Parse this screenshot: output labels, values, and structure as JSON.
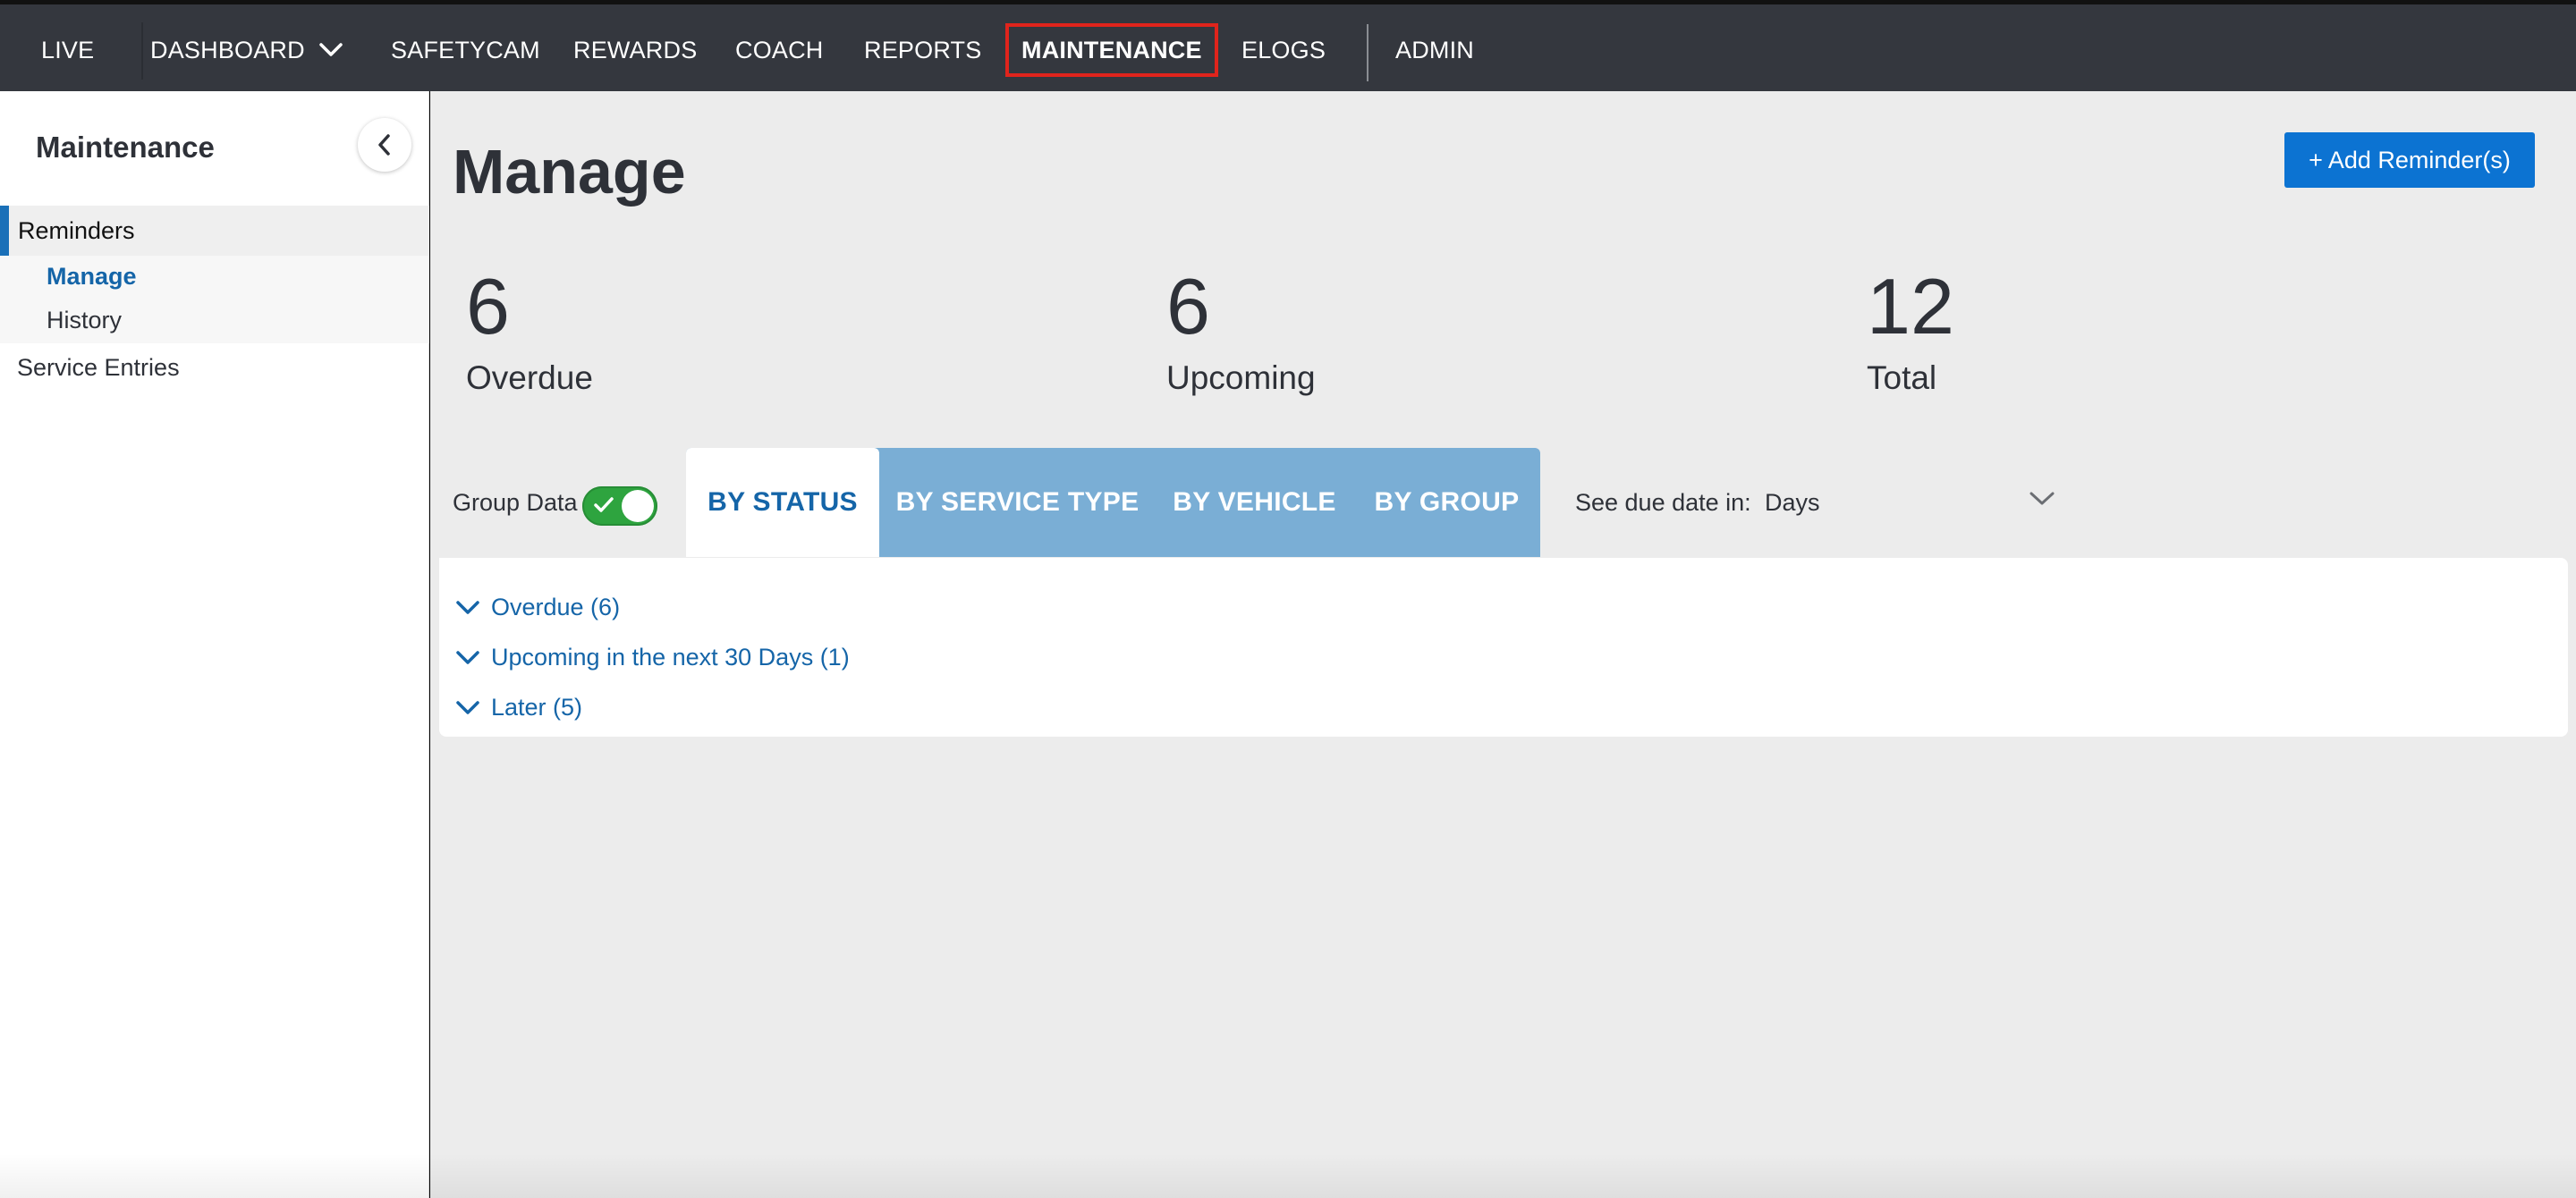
{
  "topnav": {
    "items": [
      {
        "label": "LIVE"
      },
      {
        "label": "DASHBOARD"
      },
      {
        "label": "SAFETYCAM"
      },
      {
        "label": "REWARDS"
      },
      {
        "label": "COACH"
      },
      {
        "label": "REPORTS"
      },
      {
        "label": "MAINTENANCE",
        "active": true
      },
      {
        "label": "ELOGS"
      },
      {
        "label": "ADMIN"
      }
    ]
  },
  "sidebar": {
    "title": "Maintenance",
    "sections": [
      {
        "label": "Reminders",
        "children": [
          {
            "label": "Manage",
            "active": true
          },
          {
            "label": "History"
          }
        ]
      },
      {
        "label": "Service Entries"
      }
    ]
  },
  "main": {
    "title": "Manage",
    "add_button": "+ Add Reminder(s)",
    "stats": [
      {
        "value": "6",
        "label": "Overdue"
      },
      {
        "value": "6",
        "label": "Upcoming"
      },
      {
        "value": "12",
        "label": "Total"
      }
    ],
    "group_data_label": "Group Data",
    "group_data_on": true,
    "tabs": [
      {
        "label": "BY STATUS",
        "active": true
      },
      {
        "label": "BY SERVICE TYPE"
      },
      {
        "label": "BY VEHICLE"
      },
      {
        "label": "BY GROUP"
      }
    ],
    "due_date_label": "See due date in:",
    "due_date_value": "Days",
    "groups": [
      {
        "label": "Overdue (6)"
      },
      {
        "label": "Upcoming in the next 30 Days (1)"
      },
      {
        "label": "Later (5)"
      }
    ]
  },
  "colors": {
    "nav_bg": "#34373e",
    "accent_blue": "#1565a8",
    "button_blue": "#0c73d2",
    "tab_bg": "#7aaed5",
    "toggle_on": "#2ea43f",
    "active_outline": "#e0241c"
  }
}
